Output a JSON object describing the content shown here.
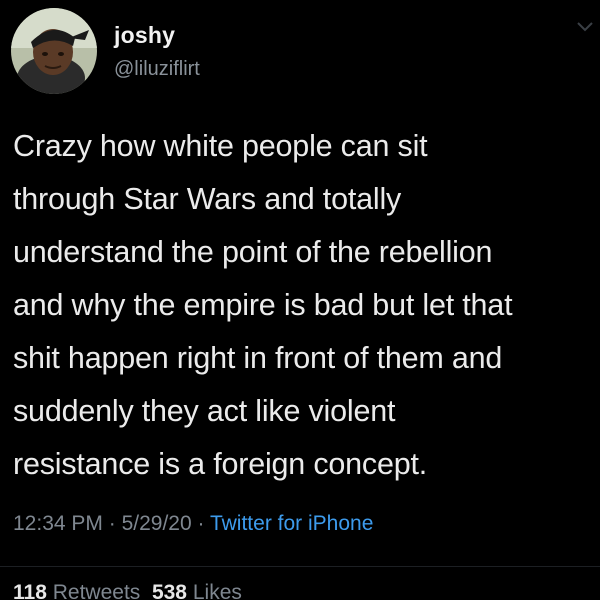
{
  "user": {
    "display_name": "joshy",
    "handle": "@liluziflirt",
    "avatar_icon": "profile-photo"
  },
  "tweet": {
    "lines": [
      "Crazy how white people can sit",
      "through Star Wars and totally",
      "understand the point of the rebellion",
      "and why the empire is bad but let that",
      "shit happen right in front of them and",
      "suddenly they act like violent",
      "resistance is a foreign concept."
    ]
  },
  "meta": {
    "time": "12:34 PM",
    "separator": "·",
    "date": "5/29/20",
    "source": "Twitter for iPhone"
  },
  "stats": {
    "retweets_count": "118",
    "retweets_label": "Retweets",
    "likes_count": "538",
    "likes_label": "Likes"
  },
  "colors": {
    "background": "#000000",
    "text": "#ebebeb",
    "muted": "#7f8790",
    "link": "#3d9bec"
  },
  "icons": {
    "more": "chevron-down-icon"
  }
}
